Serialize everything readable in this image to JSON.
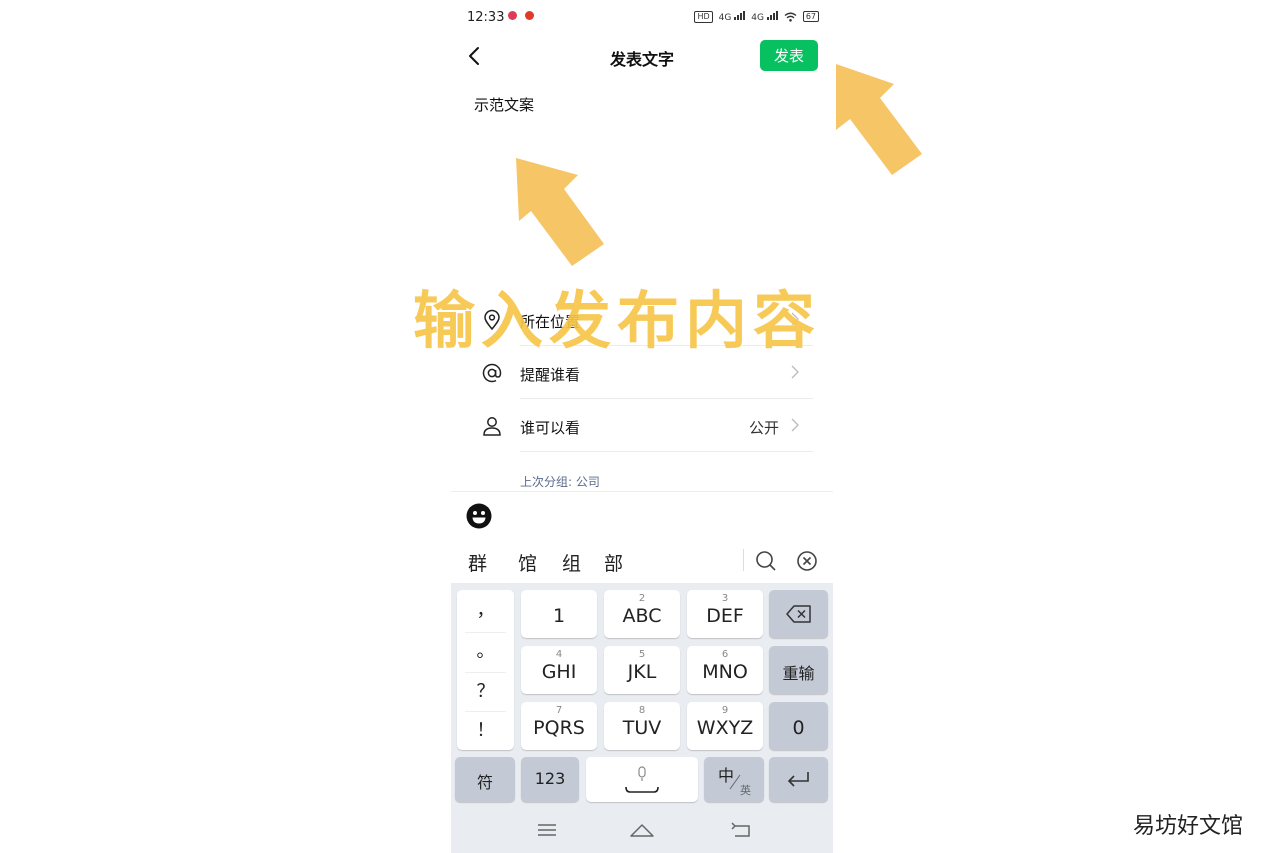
{
  "status_bar": {
    "time": "12:33",
    "network_label_1": "4G",
    "network_label_2": "4G",
    "hd_label": "HD",
    "battery": "67"
  },
  "header": {
    "title": "发表文字",
    "publish_label": "发表"
  },
  "post": {
    "text": "示范文案"
  },
  "options": [
    {
      "label": "所在位置",
      "value": "",
      "icon": "location-pin-icon"
    },
    {
      "label": "提醒谁看",
      "value": "",
      "icon": "at-sign-icon"
    },
    {
      "label": "谁可以看",
      "value": "公开",
      "icon": "person-icon"
    }
  ],
  "group_hint": "上次分组: 公司",
  "ime": {
    "candidates": [
      "群",
      "馆",
      "组",
      "部"
    ],
    "symbols": [
      "，",
      "。",
      "？",
      "！"
    ],
    "keys_row1": [
      {
        "main": "1",
        "sub": ""
      },
      {
        "main": "ABC",
        "sub": "2"
      },
      {
        "main": "DEF",
        "sub": "3"
      }
    ],
    "keys_row2": [
      {
        "main": "GHI",
        "sub": "4"
      },
      {
        "main": "JKL",
        "sub": "5"
      },
      {
        "main": "MNO",
        "sub": "6"
      }
    ],
    "keys_row3": [
      {
        "main": "PQRS",
        "sub": "7"
      },
      {
        "main": "TUV",
        "sub": "8"
      },
      {
        "main": "WXYZ",
        "sub": "9"
      }
    ],
    "reenter_label": "重输",
    "zero_label": "0",
    "symbol_key_label": "符",
    "num_key_label": "123",
    "lang_main": "中",
    "lang_sub": "英"
  },
  "annotation": {
    "text": "输入发布内容",
    "arrow_color": "#f5c566"
  },
  "watermark": "易坊好文馆",
  "colors": {
    "accent": "#07c160",
    "keyboard_bg": "#e9ecf1",
    "dark_key": "#c3cad5"
  }
}
